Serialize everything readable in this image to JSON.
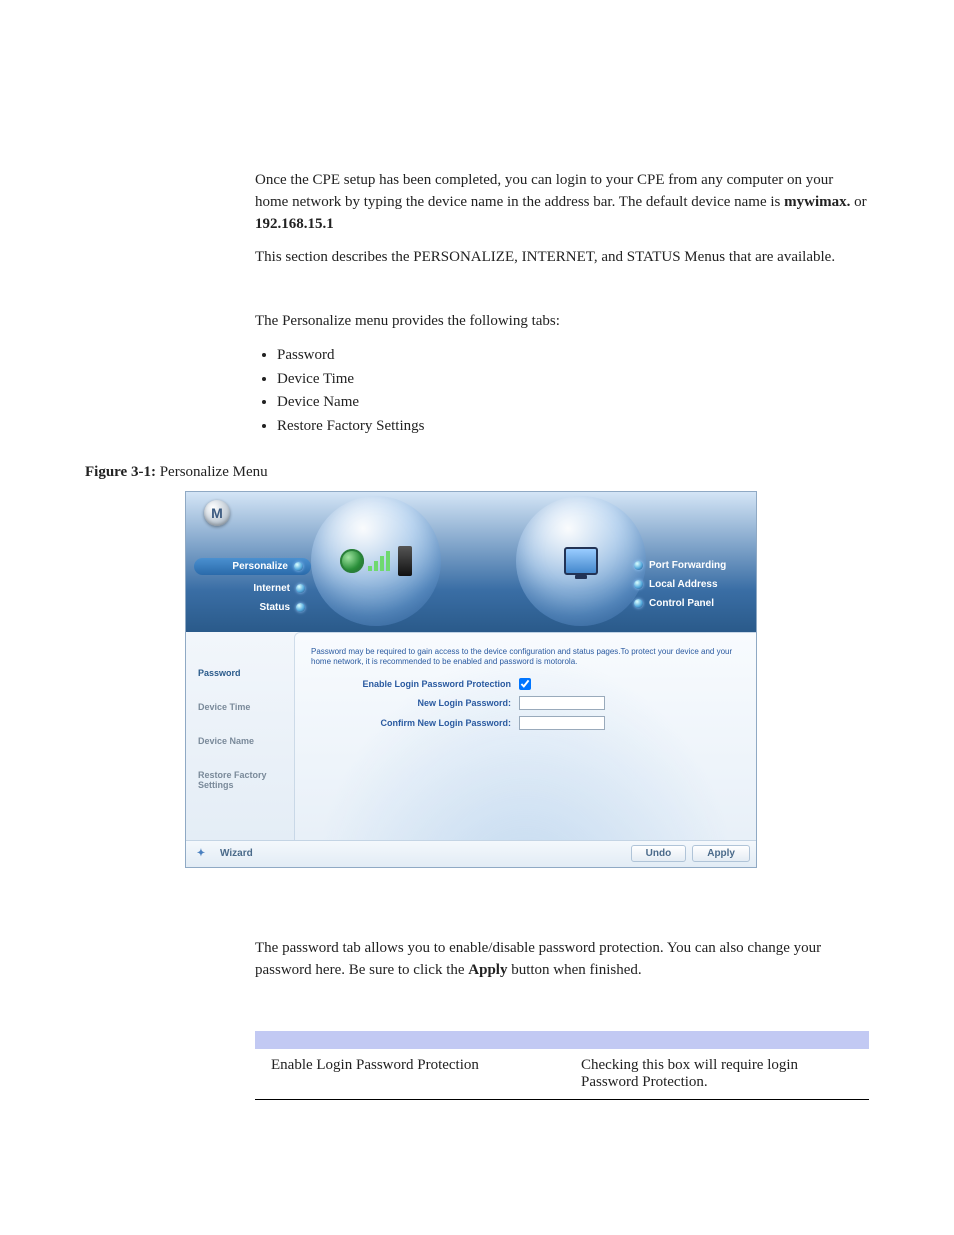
{
  "intro": {
    "para1_a": "Once the CPE setup has been completed, you can login to your CPE from any computer on your home network by typing the device name in the address bar. The default device name is ",
    "device_name": "mywimax.",
    "para1_b": " or ",
    "ip": "192.168.15.1",
    "para2": "This section describes the PERSONALIZE, INTERNET, and STATUS Menus that are available."
  },
  "personalize_intro": "The Personalize menu provides the following tabs:",
  "personalize_tabs": [
    "Password",
    "Device Time",
    "Device Name",
    "Restore Factory Settings"
  ],
  "figure_caption_label": "Figure 3-1:",
  "figure_caption_text": " Personalize Menu",
  "screenshot": {
    "logo_letter": "M",
    "nav_left": {
      "personalize": "Personalize",
      "internet": "Internet",
      "status": "Status"
    },
    "nav_right": {
      "port_forwarding": "Port Forwarding",
      "local_address": "Local Address",
      "control_panel": "Control Panel"
    },
    "sidebar": {
      "password": "Password",
      "device_time": "Device Time",
      "device_name": "Device Name",
      "restore": "Restore Factory Settings"
    },
    "content": {
      "note": "Password may be required to gain access to the device configuration and status pages.To protect your device and your home network, it is recommended to be enabled and password is motorola.",
      "enable_label": "Enable Login Password Protection",
      "new_pw_label": "New Login Password:",
      "confirm_pw_label": "Confirm New Login Password:"
    },
    "footer": {
      "wizard": "Wizard",
      "undo": "Undo",
      "apply": "Apply"
    }
  },
  "password_para_a": "The password tab allows you to enable/disable password protection. You can also change your password here. Be sure to click the ",
  "password_para_bold": "Apply",
  "password_para_b": " button when finished.",
  "table": {
    "row1_field": "Enable Login Password Protection",
    "row1_desc": "Checking this box will require login Password Protection."
  }
}
